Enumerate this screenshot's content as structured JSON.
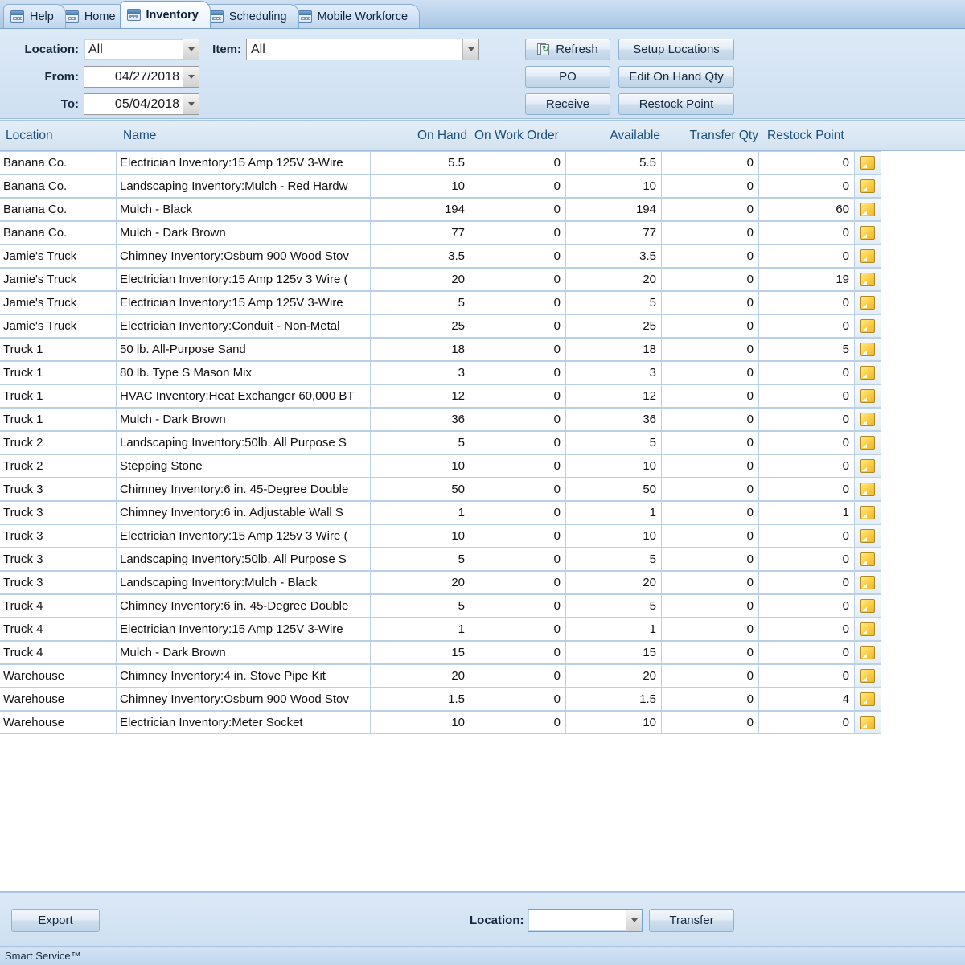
{
  "window": {
    "status_text": "Smart Service™"
  },
  "tabs": [
    {
      "label": "Help",
      "icon": "window-icon",
      "active": false
    },
    {
      "label": "Home",
      "icon": "window-icon",
      "active": false
    },
    {
      "label": "Inventory",
      "icon": "window-icon",
      "active": true
    },
    {
      "label": "Scheduling",
      "icon": "window-icon",
      "active": false
    },
    {
      "label": "Mobile Workforce",
      "icon": "window-icon",
      "active": false
    }
  ],
  "toolbar": {
    "location_label": "Location:",
    "location_value": "All",
    "from_label": "From:",
    "from_value": "04/27/2018",
    "to_label": "To:",
    "to_value": "05/04/2018",
    "item_label": "Item:",
    "item_value": "All",
    "refresh_label": "Refresh",
    "refresh_icon": "refresh-icon",
    "po_label": "PO",
    "receive_label": "Receive",
    "setup_locations_label": "Setup Locations",
    "edit_on_hand_label": "Edit On Hand Qty",
    "restock_point_label": "Restock Point"
  },
  "grid": {
    "columns": [
      "Location",
      "Name",
      "On Hand",
      "On Work Order",
      "Available",
      "Transfer Qty",
      "Restock Point"
    ],
    "row_icon": "note-icon",
    "rows": [
      [
        "Banana Co.",
        "Electrician Inventory:15 Amp 125V 3-Wire",
        "5.5",
        "0",
        "5.5",
        "0",
        "0"
      ],
      [
        "Banana Co.",
        "Landscaping Inventory:Mulch - Red Hardw",
        "10",
        "0",
        "10",
        "0",
        "0"
      ],
      [
        "Banana Co.",
        "Mulch - Black",
        "194",
        "0",
        "194",
        "0",
        "60"
      ],
      [
        "Banana Co.",
        "Mulch - Dark Brown",
        "77",
        "0",
        "77",
        "0",
        "0"
      ],
      [
        "Jamie's Truck",
        "Chimney Inventory:Osburn 900 Wood Stov",
        "3.5",
        "0",
        "3.5",
        "0",
        "0"
      ],
      [
        "Jamie's Truck",
        "Electrician Inventory:15 Amp 125v 3 Wire (",
        "20",
        "0",
        "20",
        "0",
        "19"
      ],
      [
        "Jamie's Truck",
        "Electrician Inventory:15 Amp 125V 3-Wire",
        "5",
        "0",
        "5",
        "0",
        "0"
      ],
      [
        "Jamie's Truck",
        "Electrician Inventory:Conduit - Non-Metal",
        "25",
        "0",
        "25",
        "0",
        "0"
      ],
      [
        "Truck 1",
        "50 lb. All-Purpose Sand",
        "18",
        "0",
        "18",
        "0",
        "5"
      ],
      [
        "Truck 1",
        "80 lb. Type S Mason Mix",
        "3",
        "0",
        "3",
        "0",
        "0"
      ],
      [
        "Truck 1",
        "HVAC Inventory:Heat Exchanger 60,000 BT",
        "12",
        "0",
        "12",
        "0",
        "0"
      ],
      [
        "Truck 1",
        "Mulch - Dark Brown",
        "36",
        "0",
        "36",
        "0",
        "0"
      ],
      [
        "Truck 2",
        "Landscaping Inventory:50lb. All Purpose S",
        "5",
        "0",
        "5",
        "0",
        "0"
      ],
      [
        "Truck 2",
        "Stepping Stone",
        "10",
        "0",
        "10",
        "0",
        "0"
      ],
      [
        "Truck 3",
        "Chimney Inventory:6 in. 45-Degree Double",
        "50",
        "0",
        "50",
        "0",
        "0"
      ],
      [
        "Truck 3",
        "Chimney Inventory:6 in. Adjustable Wall S",
        "1",
        "0",
        "1",
        "0",
        "1"
      ],
      [
        "Truck 3",
        "Electrician Inventory:15 Amp 125v 3 Wire (",
        "10",
        "0",
        "10",
        "0",
        "0"
      ],
      [
        "Truck 3",
        "Landscaping Inventory:50lb. All Purpose S",
        "5",
        "0",
        "5",
        "0",
        "0"
      ],
      [
        "Truck 3",
        "Landscaping Inventory:Mulch - Black",
        "20",
        "0",
        "20",
        "0",
        "0"
      ],
      [
        "Truck 4",
        "Chimney Inventory:6 in. 45-Degree Double",
        "5",
        "0",
        "5",
        "0",
        "0"
      ],
      [
        "Truck 4",
        "Electrician Inventory:15 Amp 125V 3-Wire",
        "1",
        "0",
        "1",
        "0",
        "0"
      ],
      [
        "Truck 4",
        "Mulch - Dark Brown",
        "15",
        "0",
        "15",
        "0",
        "0"
      ],
      [
        "Warehouse",
        "Chimney Inventory:4 in. Stove Pipe Kit",
        "20",
        "0",
        "20",
        "0",
        "0"
      ],
      [
        "Warehouse",
        "Chimney Inventory:Osburn 900 Wood Stov",
        "1.5",
        "0",
        "1.5",
        "0",
        "4"
      ],
      [
        "Warehouse",
        "Electrician Inventory:Meter Socket",
        "10",
        "0",
        "10",
        "0",
        "0"
      ]
    ]
  },
  "footer": {
    "export_label": "Export",
    "location_label": "Location:",
    "location_value": "",
    "transfer_label": "Transfer"
  },
  "colors": {
    "accent": "#1c4f7c",
    "toolbar_bg": "#d6e5f4",
    "grid_border": "#b9d0e6",
    "note_icon": "#fbd24e"
  }
}
